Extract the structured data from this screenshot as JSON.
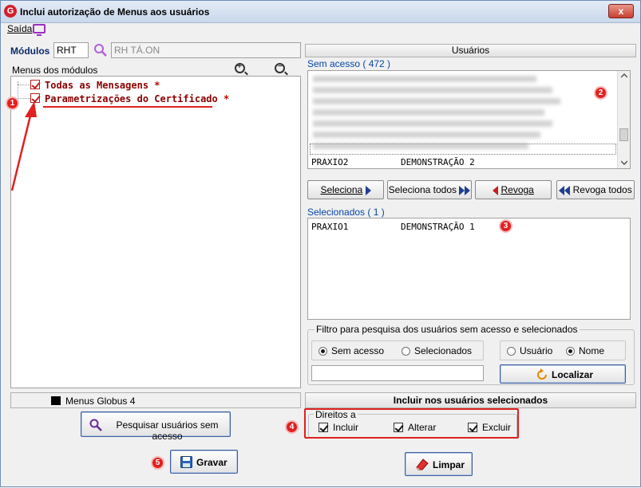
{
  "window": {
    "title": "Inclui autorização de Menus aos usuários",
    "close_label": "x",
    "logo_letter": "G"
  },
  "menu": {
    "saida": "Saída",
    "monitor_icon": "monitor-icon"
  },
  "modulos": {
    "label": "Módulos",
    "code_value": "RHT",
    "name_value": "RH TÁ.ON"
  },
  "menus_tree": {
    "label": "Menus dos módulos",
    "items": [
      {
        "label": "Todas as Mensagens",
        "star": "*"
      },
      {
        "label": "Parametrizações do Certificado",
        "star": "*"
      }
    ]
  },
  "globus": {
    "label": "Menus Globus 4"
  },
  "buttons": {
    "pesquisar": "Pesquisar usuários sem acesso",
    "gravar": "Gravar",
    "limpar": "Limpar",
    "seleciona": "Seleciona",
    "seleciona_todos": "Seleciona todos",
    "revoga": "Revoga",
    "revoga_todos": "Revoga todos",
    "localizar": "Localizar"
  },
  "usuarios": {
    "header": "Usuários",
    "sem_acesso_label": "Sem acesso ( 472 )",
    "sem_acesso_last_row": {
      "user": "PRAXIO2",
      "name": "DEMONSTRAÇÃO 2"
    },
    "selecionados_label": "Selecionados ( 1 )",
    "selecionados_rows": [
      {
        "user": "PRAXIO1",
        "name": "DEMONSTRAÇÃO 1"
      }
    ]
  },
  "filtro": {
    "title": "Filtro para pesquisa dos usuários sem acesso e selecionados",
    "radio_sem_acesso": "Sem acesso",
    "radio_selecionados": "Selecionados",
    "radio_usuario": "Usuário",
    "radio_nome": "Nome",
    "search_value": ""
  },
  "incluir": {
    "header": "Incluir nos usuários selecionados",
    "direitos_label": "Direitos a",
    "incluir": "Incluir",
    "alterar": "Alterar",
    "excluir": "Excluir"
  },
  "badges": [
    "1",
    "2",
    "3",
    "4",
    "5"
  ],
  "colors": {
    "annotation_red": "#e02020",
    "tree_text": "#8b0000",
    "label_blue": "#0645ad",
    "nav_arrow_blue": "#1f3f8f"
  }
}
